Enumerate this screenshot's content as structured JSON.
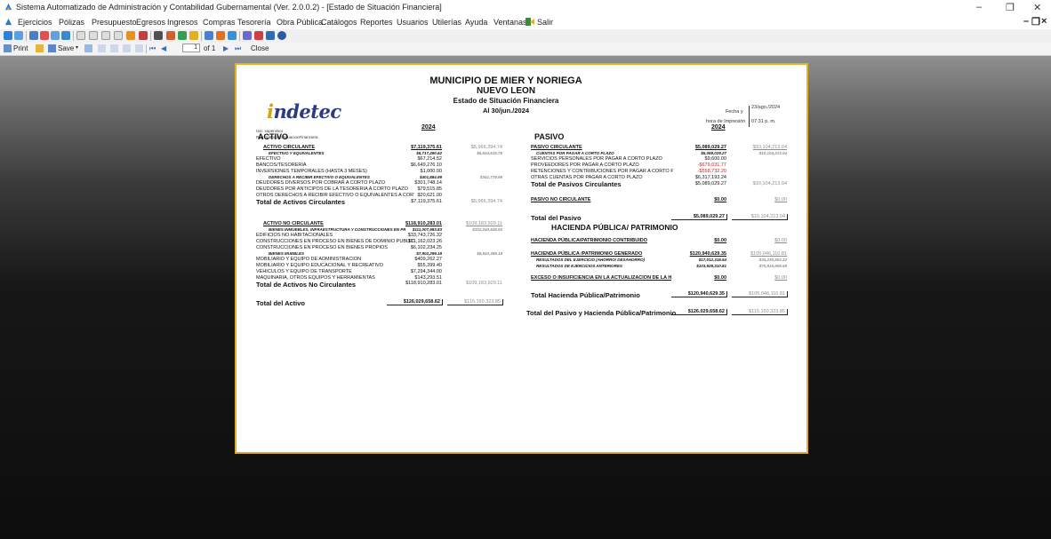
{
  "window": {
    "title": "Sistema Automatizado de Administración y Contabilidad Gubernamental  (Ver. 2.0.0.2) - [Estado de Situación Financiera]",
    "minimize": "–",
    "restore": "❐",
    "close": "✕"
  },
  "menu": {
    "items": [
      "Ejercicios",
      "Pólizas",
      "Presupuesto",
      "Egresos",
      "Ingresos",
      "Compras",
      "Tesorería",
      "Obra Pública",
      "Catálogos",
      "Reportes",
      "Usuarios",
      "Utilerías",
      "Ayuda",
      "Ventanas",
      "Salir"
    ],
    "mdi_min": "–",
    "mdi_restore": "❐",
    "mdi_close": "×"
  },
  "report_toolbar": {
    "print_label": "Print",
    "save_label": "Save",
    "page_value": "1",
    "page_total": "of 1",
    "close_label": "Close"
  },
  "report": {
    "logo": {
      "i": "i",
      "rest": "ndetec"
    },
    "user_line": "Usr: supervisor",
    "rep_line": "Rep: rptEstadoSituacionFinanciera",
    "entity": "MUNICIPIO DE MIER Y NORIEGA",
    "state": "NUEVO LEON",
    "report_name": "Estado de Situación Financiera",
    "period": "Al 30/jun./2024",
    "date_label": "Fecha y",
    "date_value": "23/ago./2024",
    "time_label": "hora de Impresión",
    "time_value": "07:31 p. m.",
    "year": "2024",
    "activo": {
      "heading": "ACTIVO",
      "circulante": {
        "label": "ACTIVO CIRCULANTE",
        "cur": "$7,119,375.61",
        "prev": "$5,966,394.74",
        "efectivo_label": "EFECTIVO Y EQUIVALENTES",
        "efectivo_cur": "$6,717,490.62",
        "efectivo_prev": "$5,624,615.75",
        "rows": [
          {
            "label": "EFECTIVO",
            "cur": "$67,214.52"
          },
          {
            "label": "BANCOS/TESORERÍA",
            "cur": "$6,649,276.10"
          },
          {
            "label": "INVERSIONES TEMPORALES (HASTA 3 MESES)",
            "cur": "$1,000.00"
          }
        ],
        "derechos_label": "DERECHOS A RECIBIR EFECTIVO O EQUIVALENTES",
        "derechos_cur": "$401,884.99",
        "derechos_prev": "$341,778.99",
        "rows2": [
          {
            "label": "DEUDORES DIVERSOS POR COBRAR A CORTO PLAZO",
            "cur": "$301,748.14"
          },
          {
            "label": "DEUDORES POR ANTICIPOS DE LA TESORERÍA A CORTO PLAZO",
            "cur": "$79,515.85"
          },
          {
            "label": "OTROS DERECHOS A RECIBIR EFECTIVO O EQUIVALENTES A CORTO PLAZO",
            "cur": "$20,621.00"
          }
        ],
        "total_label": "Total de Activos Circulantes",
        "total_cur": "$7,119,375.61",
        "total_prev": "$5,966,394.74"
      },
      "no_circulante": {
        "label": "ACTIVO NO CIRCULANTE",
        "cur": "$118,910,283.01",
        "prev": "$109,183,929.11",
        "bienes_label": "BIENES INMUEBLES, INFRAESTRUCTURA Y CONSTRUCCIONES EN PROCESO",
        "bienes_cur": "$111,007,983.83",
        "bienes_prev": "$102,240,528.93",
        "rows": [
          {
            "label": "EDIFICIOS NO HABITACIONALES",
            "cur": "$33,743,726.32"
          },
          {
            "label": "CONSTRUCCIONES EN PROCESO EN BIENES DE DOMINIO PÚBLICO",
            "cur": "$71,162,023.26"
          },
          {
            "label": "CONSTRUCCIONES EN PROCESO EN BIENES PROPIOS",
            "cur": "$6,102,234.25"
          }
        ],
        "muebles_label": "BIENES MUEBLES",
        "muebles_cur": "$7,902,299.18",
        "muebles_prev": "$6,943,399.18",
        "rows2": [
          {
            "label": "MOBILIARIO Y EQUIPO DE ADMINISTRACIÓN",
            "cur": "$409,262.27"
          },
          {
            "label": "MOBILIARIO Y EQUIPO EDUCACIONAL Y RECREATIVO",
            "cur": "$55,399.40"
          },
          {
            "label": "VEHÍCULOS Y EQUIPO DE TRANSPORTE",
            "cur": "$7,294,344.00"
          },
          {
            "label": "MAQUINARIA, OTROS EQUIPOS Y HERRAMIENTAS",
            "cur": "$143,293.51"
          }
        ],
        "total_label": "Total de Activos No Circulantes",
        "total_cur": "$118,910,283.01",
        "total_prev": "$109,183,929.11"
      },
      "total_label": "Total del Activo",
      "total_cur": "$126,029,658.62",
      "total_prev": "$115,150,323.85"
    },
    "pasivo": {
      "heading": "PASIVO",
      "circulante": {
        "label": "PASIVO CIRCULANTE",
        "cur": "$5,089,029.27",
        "prev": "$10,104,213.04",
        "cuentas_label": "CUENTAS POR PAGAR A CORTO PLAZO",
        "cuentas_cur": "$5,089,029.27",
        "cuentas_prev": "$10,104,213.04",
        "rows": [
          {
            "label": "SERVICIOS PERSONALES POR PAGAR A CORTO PLAZO",
            "cur": "$9,600.00"
          },
          {
            "label": "PROVEEDORES POR PAGAR A CORTO PLAZO",
            "cur": "-$679,031.77"
          },
          {
            "label": "RETENCIONES Y CONTRIBUCIONES POR PAGAR A CORTO PLAZO",
            "cur": "-$558,732.20"
          },
          {
            "label": "OTRAS CUENTAS POR PAGAR A CORTO PLAZO",
            "cur": "$6,317,193.24"
          }
        ],
        "total_label": "Total de Pasivos Circulantes",
        "total_cur": "$5,089,029.27",
        "total_prev": "$10,104,213.04"
      },
      "no_circulante": {
        "label": "PASIVO NO CIRCULANTE",
        "cur": "$0.00",
        "prev": "$0.00"
      },
      "total_label": "Total del Pasivo",
      "total_cur": "$5,089,029.27",
      "total_prev": "$10,104,213.04"
    },
    "hacienda": {
      "heading": "HACIENDA PÚBLICA/ PATRIMONIO",
      "contribuido_label": "HACIENDA PÚBLICA/PATRIMONIO CONTRIBUIDO",
      "contribuido_cur": "$0.00",
      "contribuido_prev": "$0.00",
      "generado_label": "HACIENDA PÚBLICA /PATRIMONIO GENERADO",
      "generado_cur": "$120,940,629.35",
      "generado_prev": "$105,046,110.81",
      "res_ejercicio_label": "RESULTADOS DEL EJERCICIO (AHORRO/ DESAHORRO)",
      "res_ejercicio_cur": "$17,012,318.54",
      "res_ejercicio_prev": "$34,230,502.22",
      "res_anteriores_label": "RESULTADOS DE EJERCICIOS ANTERIORES",
      "res_anteriores_cur": "$103,928,310.81",
      "res_anteriores_prev": "$70,815,608.59",
      "exceso_label": "EXCESO O INSUFICIENCIA EN LA ACTUALIZACIÓN DE LA HACIENDA PÚBLICA/PATRIMONIO",
      "exceso_cur": "$0.00",
      "exceso_prev": "$0.00",
      "total_label": "Total Hacienda Pública/Patrimonio",
      "total_cur": "$120,940,629.35",
      "total_prev": "$105,046,110.81"
    },
    "grand_total_label": "Total del Pasivo y Hacienda Pública/Patrimonio",
    "grand_total_cur": "$126,029,658.62",
    "grand_total_prev": "$115,150,323.85"
  }
}
